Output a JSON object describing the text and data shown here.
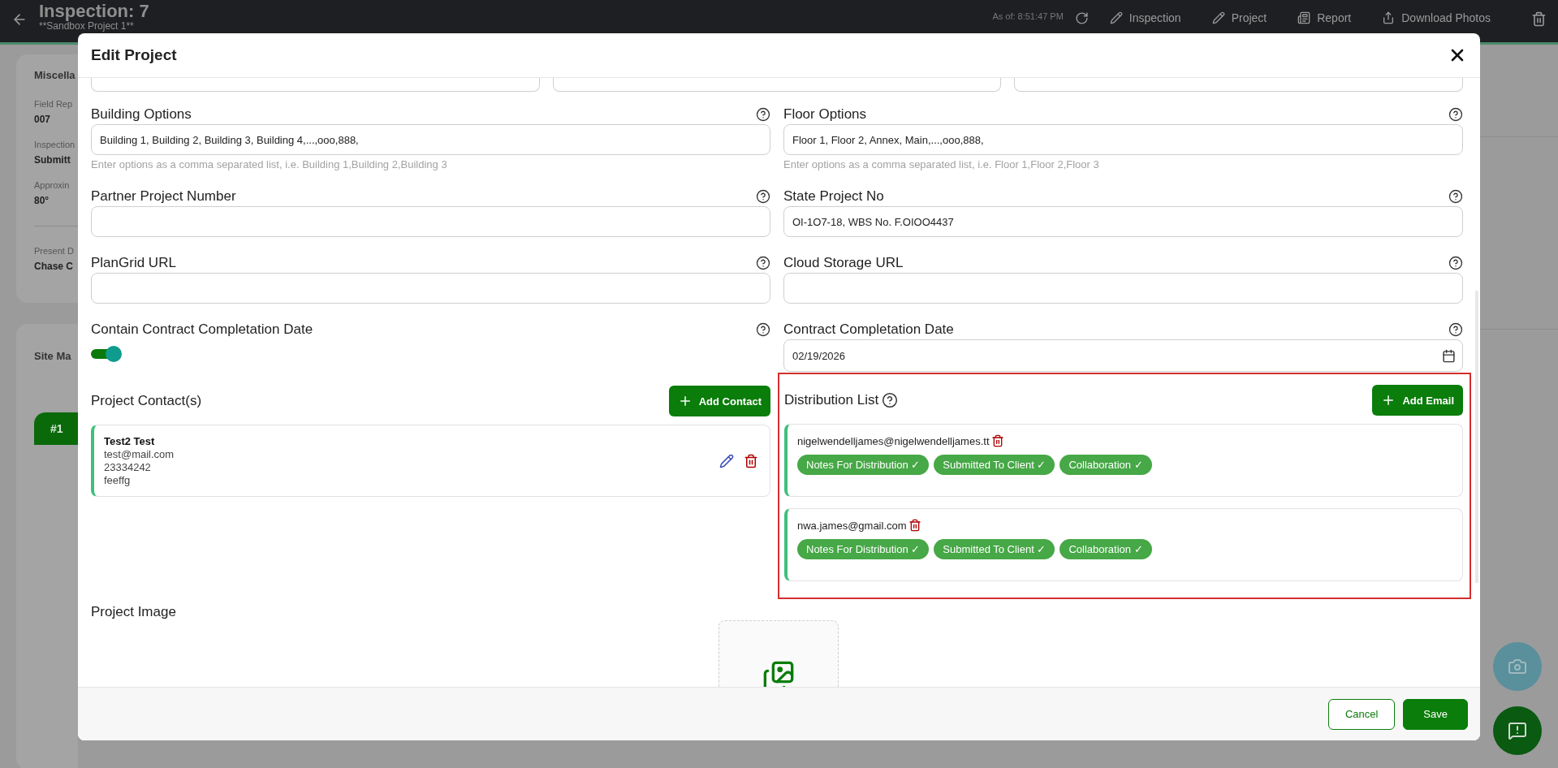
{
  "top_bar": {
    "title": "Inspection: 7",
    "subtitle": "**Sandbox Project 1**",
    "as_of": "As of: 8:51:47 PM",
    "actions": [
      {
        "label": "Inspection",
        "kind": "pencil"
      },
      {
        "label": "Project",
        "kind": "pencil"
      },
      {
        "label": "Report",
        "kind": "report"
      },
      {
        "label": "Download Photos",
        "kind": "download"
      }
    ]
  },
  "background": {
    "card_title": "Miscella",
    "fields": [
      {
        "label": "Field Rep",
        "value": "007"
      },
      {
        "label": "Inspection",
        "value": "Submitt"
      },
      {
        "label": "Approxin",
        "value": "80°"
      }
    ],
    "after_divider": {
      "label": "Present D",
      "value": "Chase C"
    },
    "site_card_title": "Site Ma",
    "site_tab": "#1"
  },
  "modal": {
    "title": "Edit Project",
    "fields": [
      {
        "kind": "text",
        "label": "Building Options",
        "value": "Building 1, Building 2, Building 3, Building 4,...,ooo,888,",
        "hint": "Enter options as a comma separated list, i.e. Building 1,Building 2,Building 3"
      },
      {
        "kind": "text",
        "label": "Floor Options",
        "value": "Floor 1, Floor 2, Annex, Main,...,ooo,888,",
        "hint": "Enter options as a comma separated list, i.e. Floor 1,Floor 2,Floor 3"
      },
      {
        "kind": "text",
        "label": "Partner Project Number"
      },
      {
        "kind": "text",
        "label": "State Project No",
        "value": "OI-1O7-18, WBS No. F.OIOO4437"
      },
      {
        "kind": "text",
        "label": "PlanGrid URL"
      },
      {
        "kind": "text",
        "label": "Cloud Storage URL"
      },
      {
        "kind": "toggle",
        "label": "Contain Contract Completation Date",
        "on": true
      },
      {
        "kind": "date",
        "label": "Contract Completation Date",
        "value": "02/19/2026"
      }
    ],
    "contacts": {
      "title": "Project Contact(s)",
      "add_label": "Add Contact",
      "items": [
        {
          "name": "Test2 Test",
          "lines": [
            "test@mail.com",
            "23334242",
            "feeffg"
          ]
        }
      ]
    },
    "distribution": {
      "title": "Distribution List",
      "add_label": "Add Email",
      "items": [
        {
          "email": "nigelwendelljames@nigelwendelljames.tt",
          "tags": [
            "Notes For Distribution ✓",
            "Submitted To Client ✓",
            "Collaboration ✓"
          ]
        },
        {
          "email": "nwa.james@gmail.com",
          "tags": [
            "Notes For Distribution ✓",
            "Submitted To Client ✓",
            "Collaboration ✓"
          ]
        }
      ]
    },
    "image_label": "Project Image",
    "buttons": [
      {
        "label": "Cancel",
        "kind": "secondary"
      },
      {
        "label": "Save",
        "kind": "primary"
      }
    ]
  }
}
